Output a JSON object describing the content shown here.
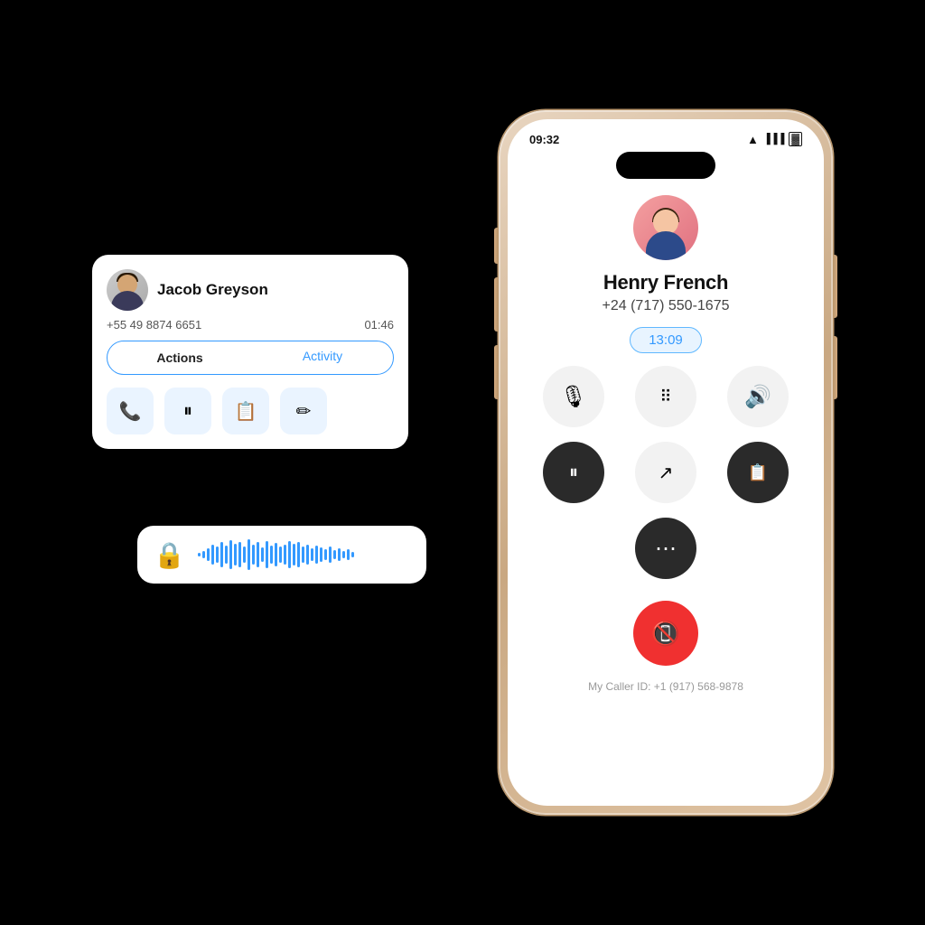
{
  "phone": {
    "status_bar": {
      "time": "09:32",
      "wifi_icon": "wifi",
      "signal_icon": "signal",
      "battery_icon": "battery"
    },
    "contact": {
      "name": "Henry French",
      "phone": "+24 (717) 550-1675",
      "timer": "13:09"
    },
    "buttons": [
      {
        "icon": "🎙",
        "label": "mute",
        "dark": false
      },
      {
        "icon": "⌨",
        "label": "keypad",
        "dark": false
      },
      {
        "icon": "🔊",
        "label": "speaker",
        "dark": false
      },
      {
        "icon": "⏸",
        "label": "hold",
        "dark": true
      },
      {
        "icon": "↗",
        "label": "transfer",
        "dark": false
      },
      {
        "icon": "📋",
        "label": "notes",
        "dark": true
      },
      {
        "icon": "⋯",
        "label": "more",
        "dark": false
      }
    ],
    "end_call": "📞",
    "caller_id": "My Caller ID: +1 (917) 568-9878"
  },
  "contact_card": {
    "name": "Jacob Greyson",
    "phone": "+55 49 8874 6651",
    "duration": "01:46",
    "tab_actions": "Actions",
    "tab_activity": "Activity",
    "action_buttons": [
      {
        "icon": "📞",
        "label": "call"
      },
      {
        "icon": "⏸",
        "label": "hold"
      },
      {
        "icon": "📋",
        "label": "notes"
      },
      {
        "icon": "✏",
        "label": "edit"
      }
    ]
  },
  "audio_card": {
    "lock_icon": "🔒",
    "waveform_bars": [
      4,
      8,
      14,
      22,
      18,
      28,
      20,
      32,
      24,
      28,
      18,
      34,
      22,
      28,
      16,
      30,
      20,
      26,
      18,
      22,
      30,
      24,
      28,
      18,
      22,
      14,
      20,
      16,
      12,
      18,
      10,
      14,
      8,
      12,
      6
    ]
  }
}
